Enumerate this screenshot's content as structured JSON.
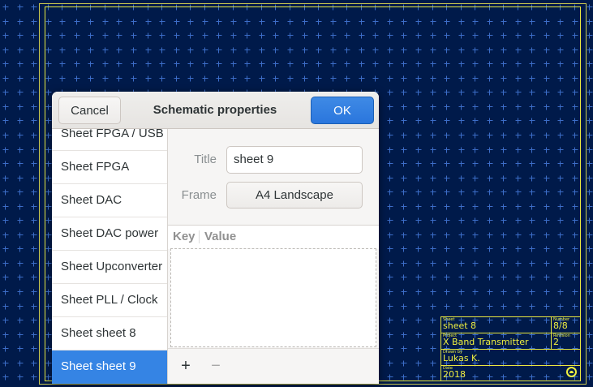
{
  "dialog": {
    "title": "Schematic properties",
    "cancel_label": "Cancel",
    "ok_label": "OK"
  },
  "sidebar": {
    "items": [
      {
        "label": "Sheet FPGA / USB"
      },
      {
        "label": "Sheet FPGA"
      },
      {
        "label": "Sheet DAC"
      },
      {
        "label": "Sheet DAC power"
      },
      {
        "label": "Sheet Upconverter"
      },
      {
        "label": "Sheet PLL / Clock"
      },
      {
        "label": "Sheet sheet 8"
      },
      {
        "label": "Sheet sheet 9"
      }
    ],
    "selected": "Sheet sheet 9"
  },
  "properties": {
    "title_label": "Title",
    "title_value": "sheet 9",
    "frame_label": "Frame",
    "frame_value": "A4 Landscape"
  },
  "table": {
    "col_key": "Key",
    "col_value": "Value"
  },
  "toolbar": {
    "add_symbol": "+",
    "remove_symbol": "−"
  },
  "title_block": {
    "sheet_label": "Sheet",
    "sheet_value": "sheet 8",
    "number_label": "Number",
    "number_value": "8/8",
    "project_label": "Project",
    "project_value": "X Band Transmitter",
    "revision_label": "Revision",
    "revision_value": "2",
    "drawn_label": "Drawn by",
    "drawn_value": "Lukas K.",
    "date_label": "Date",
    "date_value": "2018"
  },
  "colors": {
    "canvas_bg": "#001a4a",
    "grid": "#3c6ec8",
    "frame": "#e8e840",
    "accent": "#3584e4"
  }
}
